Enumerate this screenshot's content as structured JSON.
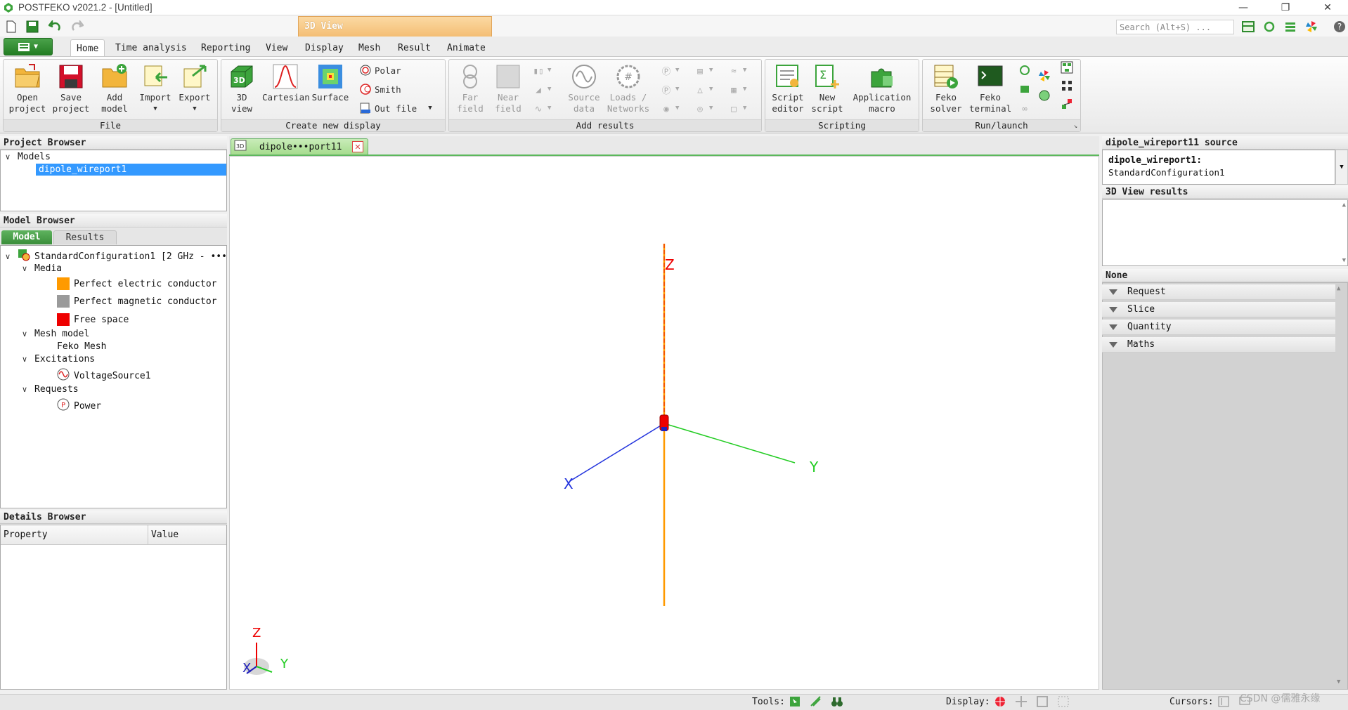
{
  "window": {
    "title": "POSTFEKO v2021.2 - [Untitled]",
    "context_tab": "3D View",
    "search_placeholder": "Search (Alt+S) ..."
  },
  "ribbon_tabs": [
    "Home",
    "Time analysis",
    "Reporting",
    "View",
    "Display",
    "Mesh",
    "Result",
    "Animate"
  ],
  "ribbon": {
    "file": {
      "label": "File",
      "open": "Open\nproject",
      "save": "Save\nproject",
      "add": "Add\nmodel",
      "import": "Import",
      "export": "Export"
    },
    "display": {
      "label": "Create new display",
      "view3d": "3D\nview",
      "cartesian": "Cartesian",
      "surface": "Surface",
      "polar": "Polar",
      "smith": "Smith",
      "outfile": "Out file"
    },
    "results": {
      "label": "Add results",
      "far": "Far\nfield",
      "near": "Near\nfield",
      "source": "Source\ndata",
      "loads": "Loads /\nNetworks"
    },
    "scripting": {
      "label": "Scripting",
      "editor": "Script\neditor",
      "new": "New\nscript",
      "macro": "Application\nmacro"
    },
    "run": {
      "label": "Run/launch",
      "solver": "Feko\nsolver",
      "terminal": "Feko\nterminal"
    }
  },
  "project_browser": {
    "title": "Project Browser",
    "models_label": "Models",
    "model_item": "dipole_wireport1"
  },
  "model_browser": {
    "title": "Model Browser",
    "tabs": [
      "Model",
      "Results"
    ],
    "config": "StandardConfiguration1 [2 GHz - •••",
    "media": "Media",
    "media_items": [
      {
        "label": "Perfect electric conductor",
        "color": "#ff9a00"
      },
      {
        "label": "Perfect magnetic conductor",
        "color": "#9a9a9a"
      },
      {
        "label": "Free space",
        "color": "#ee0000"
      }
    ],
    "mesh_model": "Mesh model",
    "feko_mesh": "Feko Mesh",
    "excitations": "Excitations",
    "voltage_source": "VoltageSource1",
    "requests": "Requests",
    "power": "Power"
  },
  "details_browser": {
    "title": "Details Browser",
    "col_property": "Property",
    "col_value": "Value"
  },
  "view": {
    "doc_tab": "dipole•••port11",
    "axis_x": "X",
    "axis_y": "Y",
    "axis_z": "Z"
  },
  "right_panel": {
    "source_title": "dipole_wireport11 source",
    "source_name": "dipole_wireport1:",
    "source_config": "StandardConfiguration1",
    "results_title": "3D View results",
    "none_title": "None",
    "accordion": [
      "Request",
      "Slice",
      "Quantity",
      "Maths"
    ]
  },
  "statusbar": {
    "tools": "Tools:",
    "display": "Display:",
    "cursors": "Cursors:",
    "watermark": "CSDN @儒雅永缘"
  }
}
